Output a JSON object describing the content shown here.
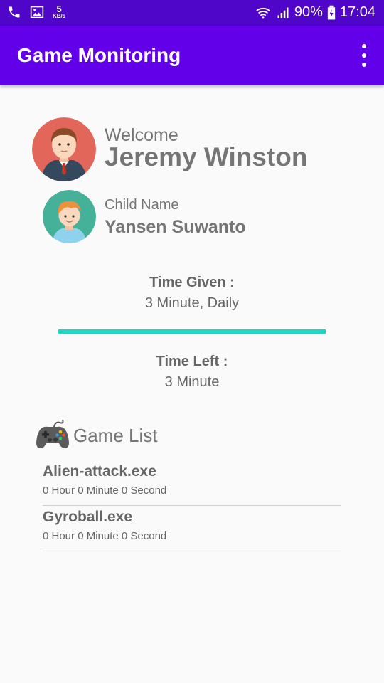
{
  "status_bar": {
    "speed_value": "5",
    "speed_unit": "KB/s",
    "battery": "90%",
    "time": "17:04",
    "icons": [
      "phone-icon",
      "image-icon",
      "wifi-icon",
      "signal-icon",
      "battery-icon"
    ]
  },
  "app_bar": {
    "title": "Game Monitoring",
    "menu_icon": "more-vert-icon"
  },
  "profile": {
    "welcome_label": "Welcome",
    "parent_name": "Jeremy Winston",
    "child_label": "Child Name",
    "child_name": "Yansen Suwanto"
  },
  "time": {
    "given_label": "Time Given :",
    "given_value": "3 Minute, Daily",
    "left_label": "Time Left :",
    "left_value": "3 Minute",
    "progress_fraction": 1.0
  },
  "game_list": {
    "title": "Game List",
    "icon": "gamepad-icon",
    "items": [
      {
        "name": "Alien-attack.exe",
        "time": "0 Hour 0 Minute 0 Second"
      },
      {
        "name": "Gyroball.exe",
        "time": "0 Hour 0 Minute 0 Second"
      }
    ]
  },
  "colors": {
    "status_bar": "#4f06c9",
    "app_bar": "#6200ea",
    "progress": "#1bd8c6",
    "text_gray": "#757575"
  }
}
